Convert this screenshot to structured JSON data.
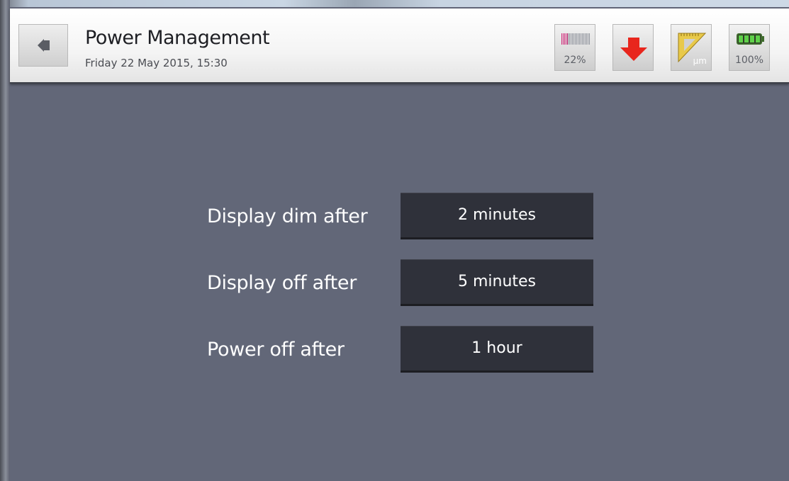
{
  "header": {
    "title": "Power Management",
    "subtitle": "Friday 22 May 2015, 15:30"
  },
  "status_icons": {
    "signal": {
      "icon": "signal-strength-icon",
      "text": "22%",
      "level": 0.22
    },
    "download": {
      "icon": "download-arrow-icon",
      "color": "#e8261d"
    },
    "measure": {
      "icon": "ruler-triangle-icon",
      "text": "μm",
      "color": "#e8c94a"
    },
    "battery": {
      "icon": "battery-icon",
      "text": "100%",
      "level": 1.0,
      "color": "#5fd14a"
    }
  },
  "settings": [
    {
      "label": "Display dim after",
      "value": "2 minutes"
    },
    {
      "label": "Display off after",
      "value": "5 minutes"
    },
    {
      "label": "Power off after",
      "value": "1 hour"
    }
  ],
  "colors": {
    "background": "#626778",
    "button": "#2f313a",
    "header": "#f4f4f4"
  }
}
